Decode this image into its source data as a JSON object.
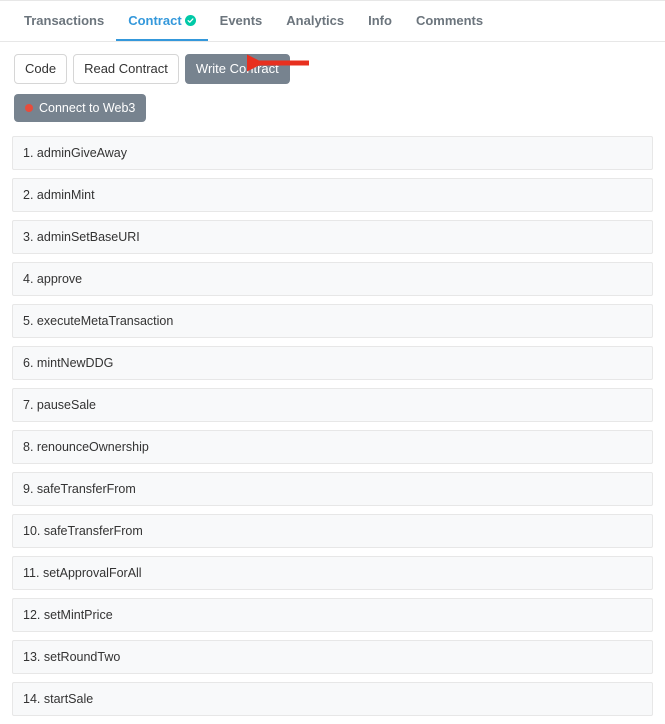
{
  "tabs": [
    {
      "label": "Transactions"
    },
    {
      "label": "Contract",
      "active": true,
      "verified": true
    },
    {
      "label": "Events"
    },
    {
      "label": "Analytics"
    },
    {
      "label": "Info"
    },
    {
      "label": "Comments"
    }
  ],
  "subTabs": {
    "code": "Code",
    "read": "Read Contract",
    "write": "Write Contract"
  },
  "connect": {
    "label": "Connect to Web3"
  },
  "functions": [
    {
      "index": "1.",
      "name": "adminGiveAway"
    },
    {
      "index": "2.",
      "name": "adminMint"
    },
    {
      "index": "3.",
      "name": "adminSetBaseURI"
    },
    {
      "index": "4.",
      "name": "approve"
    },
    {
      "index": "5.",
      "name": "executeMetaTransaction"
    },
    {
      "index": "6.",
      "name": "mintNewDDG"
    },
    {
      "index": "7.",
      "name": "pauseSale"
    },
    {
      "index": "8.",
      "name": "renounceOwnership"
    },
    {
      "index": "9.",
      "name": "safeTransferFrom"
    },
    {
      "index": "10.",
      "name": "safeTransferFrom"
    },
    {
      "index": "11.",
      "name": "setApprovalForAll"
    },
    {
      "index": "12.",
      "name": "setMintPrice"
    },
    {
      "index": "13.",
      "name": "setRoundTwo"
    },
    {
      "index": "14.",
      "name": "startSale"
    }
  ]
}
